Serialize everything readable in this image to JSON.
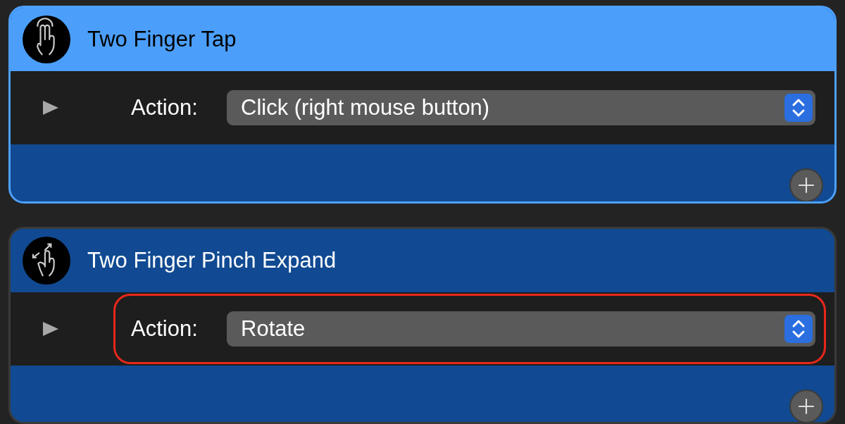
{
  "gestures": [
    {
      "title": "Two Finger Tap",
      "kind": "tap",
      "selected": true,
      "action_label": "Action:",
      "action_value": "Click (right mouse button)",
      "highlighted": false
    },
    {
      "title": "Two Finger Pinch Expand",
      "kind": "pinch",
      "selected": false,
      "action_label": "Action:",
      "action_value": "Rotate",
      "highlighted": true
    }
  ]
}
